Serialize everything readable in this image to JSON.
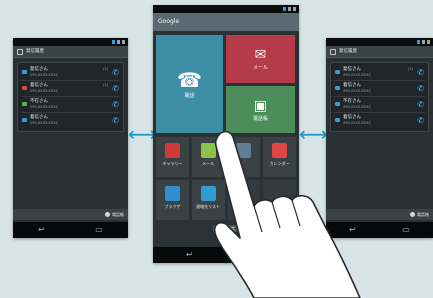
{
  "left_phone": {
    "app_title": "発信履歴",
    "history": [
      {
        "name": "発信さん",
        "detail": "090-XXXX-XXXX",
        "count": "(2)",
        "type": "in"
      },
      {
        "name": "着信さん",
        "detail": "090-XXXX-XXXX",
        "count": "(1)",
        "type": "miss"
      },
      {
        "name": "不在さん",
        "detail": "090-XXXX-XXXX",
        "count": "",
        "type": "out"
      },
      {
        "name": "着信さん",
        "detail": "090-XXXX-XXXX",
        "count": "",
        "type": "in"
      }
    ],
    "action_label": "電話帳",
    "nav": [
      "↩",
      "▭"
    ]
  },
  "center_phone": {
    "search_label": "Google",
    "tiles": {
      "phone_label": "電話",
      "mail_label": "メール",
      "contacts_label": "電話帳"
    },
    "apps": [
      {
        "name": "ギャラリー",
        "color": "#d23a3a"
      },
      {
        "name": "メール",
        "color": "#8bc34a"
      },
      {
        "name": "",
        "color": "#5f7e91"
      },
      {
        "name": "カレンダー",
        "color": "#e04646"
      },
      {
        "name": "ブラウザ",
        "color": "#2f8fd1"
      },
      {
        "name": "連絡先リスト",
        "color": "#2f9ed1"
      },
      {
        "name": "",
        "color": ""
      },
      {
        "name": "",
        "color": ""
      }
    ],
    "edit_label": "壁紙設定",
    "nav": [
      "↩",
      "▭"
    ]
  },
  "right_phone": {
    "app_title": "発信履歴",
    "history": [
      {
        "name": "発信さん",
        "detail": "090-XXXX-XXXX",
        "count": "(2)",
        "type": "in"
      },
      {
        "name": "着信さん",
        "detail": "090-XXXX-XXXX",
        "count": "",
        "type": "in"
      },
      {
        "name": "不在さん",
        "detail": "090-XXXX-XXXX",
        "count": "",
        "type": "in"
      },
      {
        "name": "着信さん",
        "detail": "090-XXXX-XXXX",
        "count": "",
        "type": "in"
      }
    ],
    "action_label": "電話帳",
    "nav": [
      "↩",
      "▭"
    ]
  },
  "arrows": {
    "left": "⟷",
    "right": "⟷"
  },
  "colors": {
    "accent": "#1a9ac4",
    "background": "#d7e4e6"
  }
}
